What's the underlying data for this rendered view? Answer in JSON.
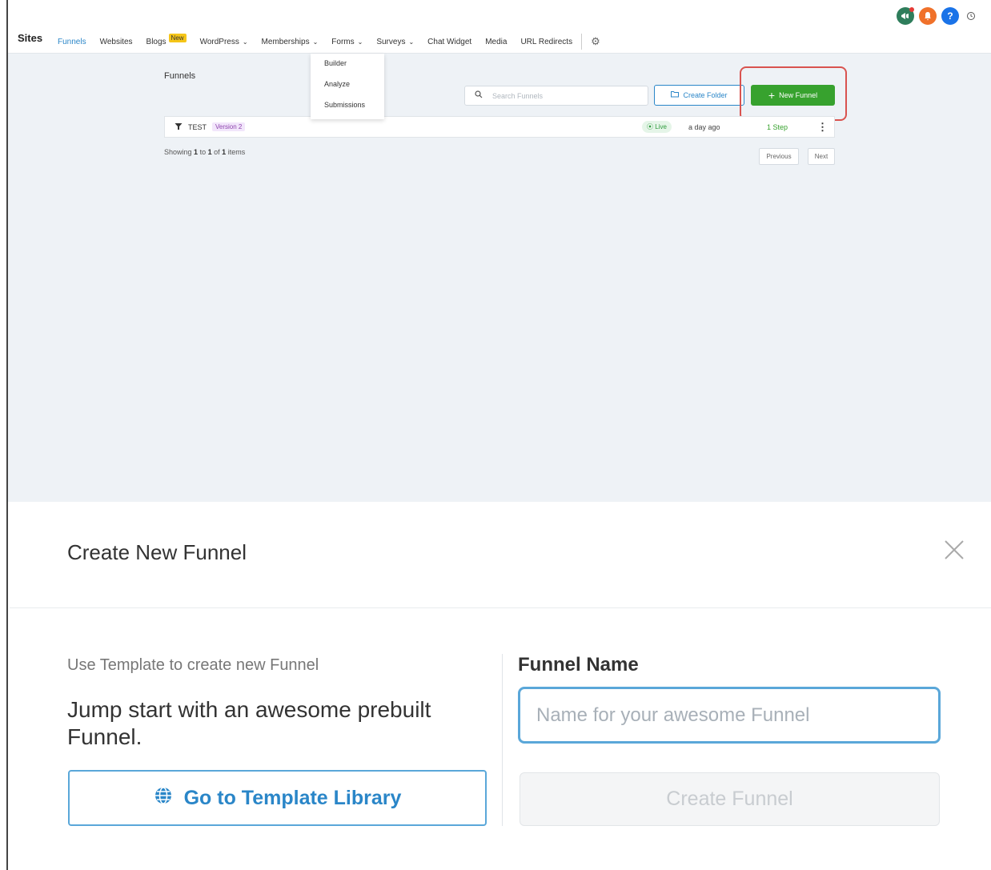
{
  "header": {
    "title": "Sites",
    "nav": [
      {
        "label": "Funnels",
        "active": true
      },
      {
        "label": "Websites"
      },
      {
        "label": "Blogs",
        "badge": "New"
      },
      {
        "label": "WordPress",
        "dropdown": true
      },
      {
        "label": "Memberships",
        "dropdown": true
      },
      {
        "label": "Forms",
        "dropdown": true
      },
      {
        "label": "Surveys",
        "dropdown": true
      },
      {
        "label": "Chat Widget"
      },
      {
        "label": "Media"
      },
      {
        "label": "URL Redirects"
      }
    ],
    "settings_icon": "gear-icon",
    "top_icons": [
      "megaphone-icon",
      "bell-icon",
      "help-icon",
      "history-icon"
    ],
    "help_glyph": "?"
  },
  "forms_menu": {
    "items": [
      "Builder",
      "Analyze",
      "Submissions"
    ]
  },
  "funnels_page": {
    "title": "Funnels",
    "search_placeholder": "Search Funnels",
    "create_folder_label": "Create Folder",
    "new_funnel_label": "New Funnel",
    "rows": [
      {
        "name": "TEST",
        "version": "Version 2",
        "status": "Live",
        "updated": "a day ago",
        "steps": "1 Step"
      }
    ],
    "pagination": {
      "showing_prefix": "Showing",
      "from": "1",
      "to_word": "to",
      "to": "1",
      "of_word": "of",
      "total": "1",
      "items_word": "items",
      "previous_label": "Previous",
      "next_label": "Next"
    }
  },
  "modal": {
    "title": "Create New Funnel",
    "template_caption": "Use Template to create new Funnel",
    "jumpstart_text": "Jump start with an awesome prebuilt Funnel.",
    "template_button_label": "Go to Template Library",
    "funnel_name_label": "Funnel Name",
    "funnel_name_placeholder": "Name for your awesome Funnel",
    "funnel_name_value": "",
    "create_button_label": "Create Funnel"
  },
  "colors": {
    "accent": "#2a86c8",
    "primary_action": "#37a22e",
    "highlight_box": "#d9534f",
    "page_bg": "#eef2f6"
  }
}
